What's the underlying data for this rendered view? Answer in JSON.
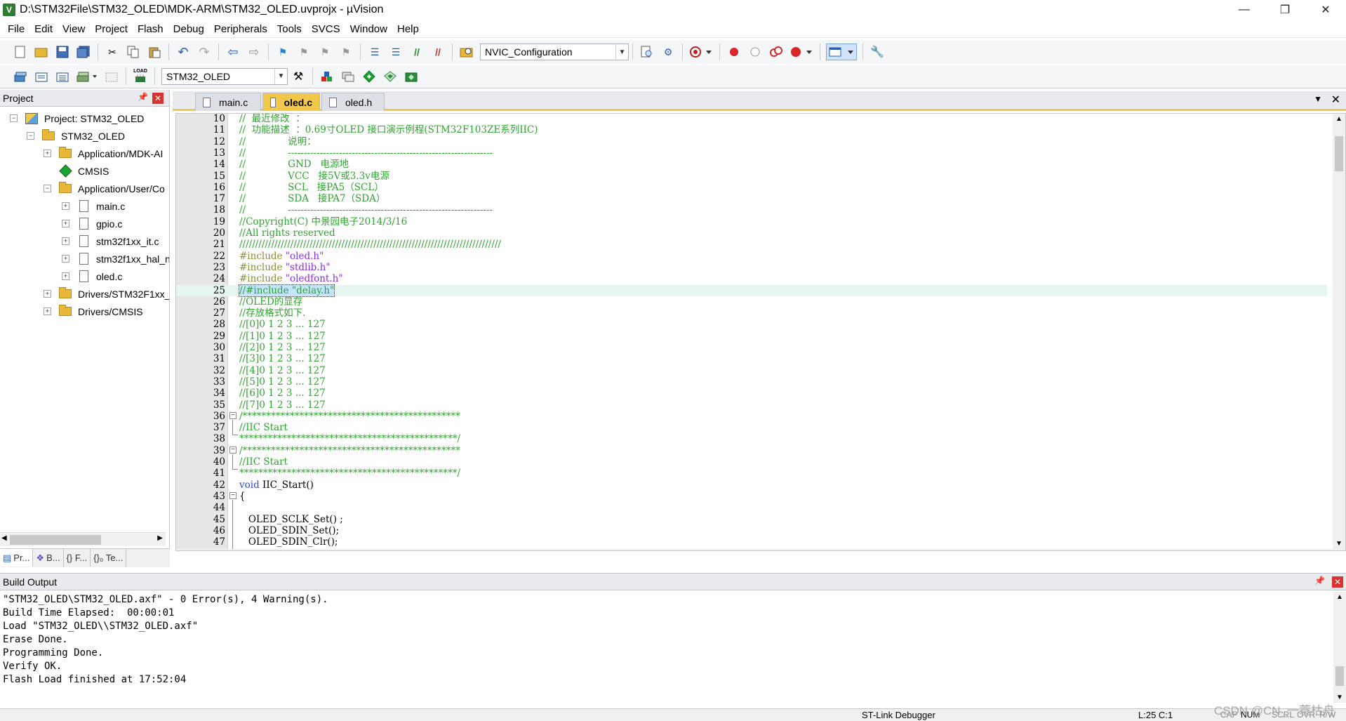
{
  "window": {
    "title": "D:\\STM32File\\STM32_OLED\\MDK-ARM\\STM32_OLED.uvprojx - µVision",
    "controls": [
      "—",
      "❐",
      "✕"
    ]
  },
  "menu": [
    "File",
    "Edit",
    "View",
    "Project",
    "Flash",
    "Debug",
    "Peripherals",
    "Tools",
    "SVCS",
    "Window",
    "Help"
  ],
  "toolbar": {
    "config_combo": "NVIC_Configuration",
    "target_combo": "STM32_OLED",
    "load_label": "LOAD"
  },
  "project_panel": {
    "title": "Project",
    "tree": [
      {
        "label": "Project: STM32_OLED",
        "level": 0,
        "icon": "project-icon",
        "expander": "−"
      },
      {
        "label": "STM32_OLED",
        "level": 1,
        "icon": "folder-icon",
        "expander": "−"
      },
      {
        "label": "Application/MDK-AI",
        "level": 2,
        "icon": "folder-icon",
        "expander": "+"
      },
      {
        "label": "CMSIS",
        "level": 2,
        "icon": "diamond-icon",
        "expander": ""
      },
      {
        "label": "Application/User/Co",
        "level": 2,
        "icon": "folder-icon",
        "expander": "−"
      },
      {
        "label": "main.c",
        "level": 3,
        "icon": "file-icon",
        "expander": "+"
      },
      {
        "label": "gpio.c",
        "level": 3,
        "icon": "file-icon",
        "expander": "+"
      },
      {
        "label": "stm32f1xx_it.c",
        "level": 3,
        "icon": "file-icon",
        "expander": "+"
      },
      {
        "label": "stm32f1xx_hal_n",
        "level": 3,
        "icon": "file-icon",
        "expander": "+"
      },
      {
        "label": "oled.c",
        "level": 3,
        "icon": "file-icon",
        "expander": "+"
      },
      {
        "label": "Drivers/STM32F1xx_",
        "level": 2,
        "icon": "folder-icon",
        "expander": "+"
      },
      {
        "label": "Drivers/CMSIS",
        "level": 2,
        "icon": "folder-icon",
        "expander": "+"
      }
    ],
    "bottom_tabs": [
      "Pr...",
      "B...",
      "{} F...",
      "{}₀ Te..."
    ]
  },
  "editor": {
    "tabs": [
      {
        "label": "main.c",
        "active": false
      },
      {
        "label": "oled.c",
        "active": true
      },
      {
        "label": "oled.h",
        "active": false
      }
    ],
    "highlighted_line": 25,
    "lines": [
      {
        "n": "10",
        "parts": [
          [
            "c",
            "//  最近修改  ："
          ]
        ]
      },
      {
        "n": "11",
        "parts": [
          [
            "c",
            "//  功能描述  ：0.69寸OLED 接口演示例程(STM32F103ZE系列IIC)"
          ]
        ]
      },
      {
        "n": "12",
        "parts": [
          [
            "c",
            "//              说明："
          ]
        ]
      },
      {
        "n": "13",
        "parts": [
          [
            "c",
            "//              ----------------------------------------------------------------"
          ]
        ]
      },
      {
        "n": "14",
        "parts": [
          [
            "c",
            "//              GND   电源地"
          ]
        ]
      },
      {
        "n": "15",
        "parts": [
          [
            "c",
            "//              VCC   接5V或3.3v电源"
          ]
        ]
      },
      {
        "n": "16",
        "parts": [
          [
            "c",
            "//              SCL   接PA5（SCL）"
          ]
        ]
      },
      {
        "n": "17",
        "parts": [
          [
            "c",
            "//              SDA   接PA7（SDA）"
          ]
        ]
      },
      {
        "n": "18",
        "parts": [
          [
            "c",
            "//              ----------------------------------------------------------------"
          ]
        ]
      },
      {
        "n": "19",
        "parts": [
          [
            "c",
            "//Copyright(C) 中景园电子2014/3/16"
          ]
        ]
      },
      {
        "n": "20",
        "parts": [
          [
            "c",
            "//All rights reserved"
          ]
        ]
      },
      {
        "n": "21",
        "parts": [
          [
            "c",
            "//////////////////////////////////////////////////////////////////////////////////"
          ]
        ]
      },
      {
        "n": "22",
        "parts": [
          [
            "p",
            "#include "
          ],
          [
            "s",
            "\"oled.h\""
          ]
        ]
      },
      {
        "n": "23",
        "parts": [
          [
            "p",
            "#include "
          ],
          [
            "s",
            "\"stdlib.h\""
          ]
        ]
      },
      {
        "n": "24",
        "parts": [
          [
            "p",
            "#include "
          ],
          [
            "s",
            "\"oledfont.h\""
          ]
        ]
      },
      {
        "n": "25",
        "parts": [
          [
            "sel",
            "//#include \"delay.h\""
          ]
        ]
      },
      {
        "n": "26",
        "parts": [
          [
            "c",
            "//OLED的显存"
          ]
        ]
      },
      {
        "n": "27",
        "parts": [
          [
            "c",
            "//存放格式如下."
          ]
        ]
      },
      {
        "n": "28",
        "parts": [
          [
            "c",
            "//[0]0 1 2 3 ... 127"
          ]
        ]
      },
      {
        "n": "29",
        "parts": [
          [
            "c",
            "//[1]0 1 2 3 ... 127"
          ]
        ]
      },
      {
        "n": "30",
        "parts": [
          [
            "c",
            "//[2]0 1 2 3 ... 127"
          ]
        ]
      },
      {
        "n": "31",
        "parts": [
          [
            "c",
            "//[3]0 1 2 3 ... 127"
          ]
        ]
      },
      {
        "n": "32",
        "parts": [
          [
            "c",
            "//[4]0 1 2 3 ... 127"
          ]
        ]
      },
      {
        "n": "33",
        "parts": [
          [
            "c",
            "//[5]0 1 2 3 ... 127"
          ]
        ]
      },
      {
        "n": "34",
        "parts": [
          [
            "c",
            "//[6]0 1 2 3 ... 127"
          ]
        ]
      },
      {
        "n": "35",
        "parts": [
          [
            "c",
            "//[7]0 1 2 3 ... 127"
          ]
        ]
      },
      {
        "n": "36",
        "parts": [
          [
            "c",
            "/**********************************************"
          ]
        ]
      },
      {
        "n": "37",
        "parts": [
          [
            "c",
            "//IIC Start"
          ]
        ]
      },
      {
        "n": "38",
        "parts": [
          [
            "c",
            "**********************************************/"
          ]
        ]
      },
      {
        "n": "39",
        "parts": [
          [
            "c",
            "/**********************************************"
          ]
        ]
      },
      {
        "n": "40",
        "parts": [
          [
            "c",
            "//IIC Start"
          ]
        ]
      },
      {
        "n": "41",
        "parts": [
          [
            "c",
            "**********************************************/"
          ]
        ]
      },
      {
        "n": "42",
        "parts": [
          [
            "k",
            "void "
          ],
          [
            "t",
            "IIC_Start()"
          ]
        ]
      },
      {
        "n": "43",
        "parts": [
          [
            "t",
            "{"
          ]
        ]
      },
      {
        "n": "44",
        "parts": [
          [
            "t",
            ""
          ]
        ]
      },
      {
        "n": "45",
        "parts": [
          [
            "t",
            "   OLED_SCLK_Set() ;"
          ]
        ]
      },
      {
        "n": "46",
        "parts": [
          [
            "t",
            "   OLED_SDIN_Set();"
          ]
        ]
      },
      {
        "n": "47",
        "parts": [
          [
            "t",
            "   OLED_SDIN_Clr();"
          ]
        ]
      }
    ]
  },
  "build_output": {
    "title": "Build Output",
    "lines": [
      "\"STM32_OLED\\STM32_OLED.axf\" - 0 Error(s), 4 Warning(s).",
      "Build Time Elapsed:  00:00:01",
      "Load \"STM32_OLED\\\\STM32_OLED.axf\"",
      "Erase Done.",
      "Programming Done.",
      "Verify OK.",
      "Flash Load finished at 17:52:04"
    ]
  },
  "status": {
    "debugger": "ST-Link Debugger",
    "position": "L:25 C:1",
    "cap": "CAP",
    "num": "NUM",
    "scrl": "SCRL",
    "ovr": "OVR",
    "rw": "R/W"
  },
  "watermark": "CSDN @CN_一蓑枯舟"
}
